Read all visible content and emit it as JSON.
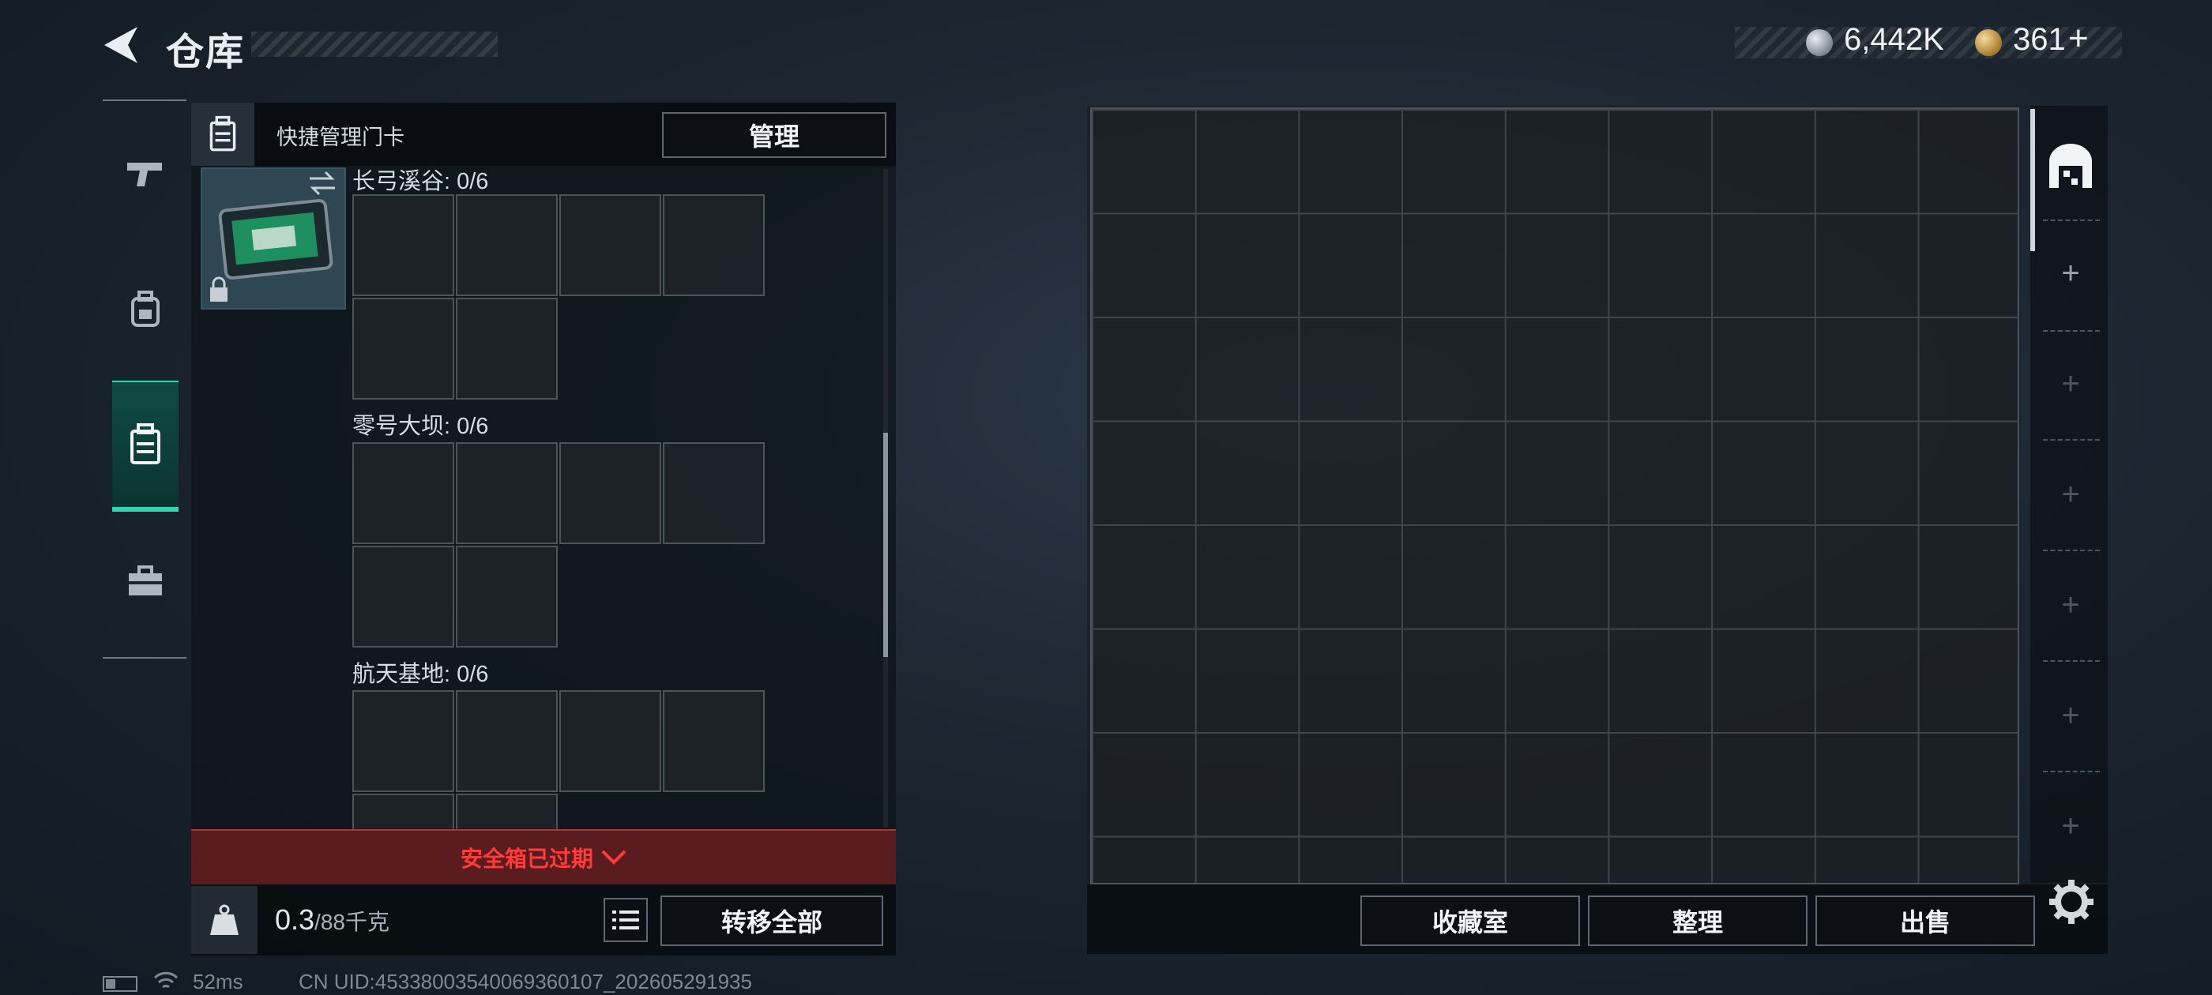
{
  "header": {
    "title": "仓库",
    "currency_silver": "6,442K",
    "currency_gold": "361",
    "gold_add": "+"
  },
  "nav": {
    "items": [
      {
        "name": "weapons",
        "icon": "pistol-icon"
      },
      {
        "name": "equipment",
        "icon": "backpack-icon"
      },
      {
        "name": "keycards",
        "icon": "keycard-case-icon",
        "active": true
      },
      {
        "name": "tools",
        "icon": "toolbox-icon"
      }
    ]
  },
  "keycard_panel": {
    "header_label": "快捷管理门卡",
    "manage_label": "管理",
    "categories": [
      {
        "label": "长弓溪谷: 0/6"
      },
      {
        "label": "零号大坝: 0/6"
      },
      {
        "label": "航天基地: 0/6"
      }
    ],
    "expired_label": "安全箱已过期",
    "weight_current": "0.3",
    "weight_max": "/88千克",
    "transfer_all_label": "转移全部"
  },
  "storage": {
    "collection_label": "收藏室",
    "sort_label": "整理",
    "sell_label": "出售",
    "tab_plus": "+"
  },
  "status_bar": {
    "ping": "52ms",
    "uid": "CN UID:453380035400693601​07_202605291935"
  },
  "colors": {
    "accent": "#2fd6b2",
    "warning": "#ff3b3b",
    "background": "#1c2631"
  }
}
